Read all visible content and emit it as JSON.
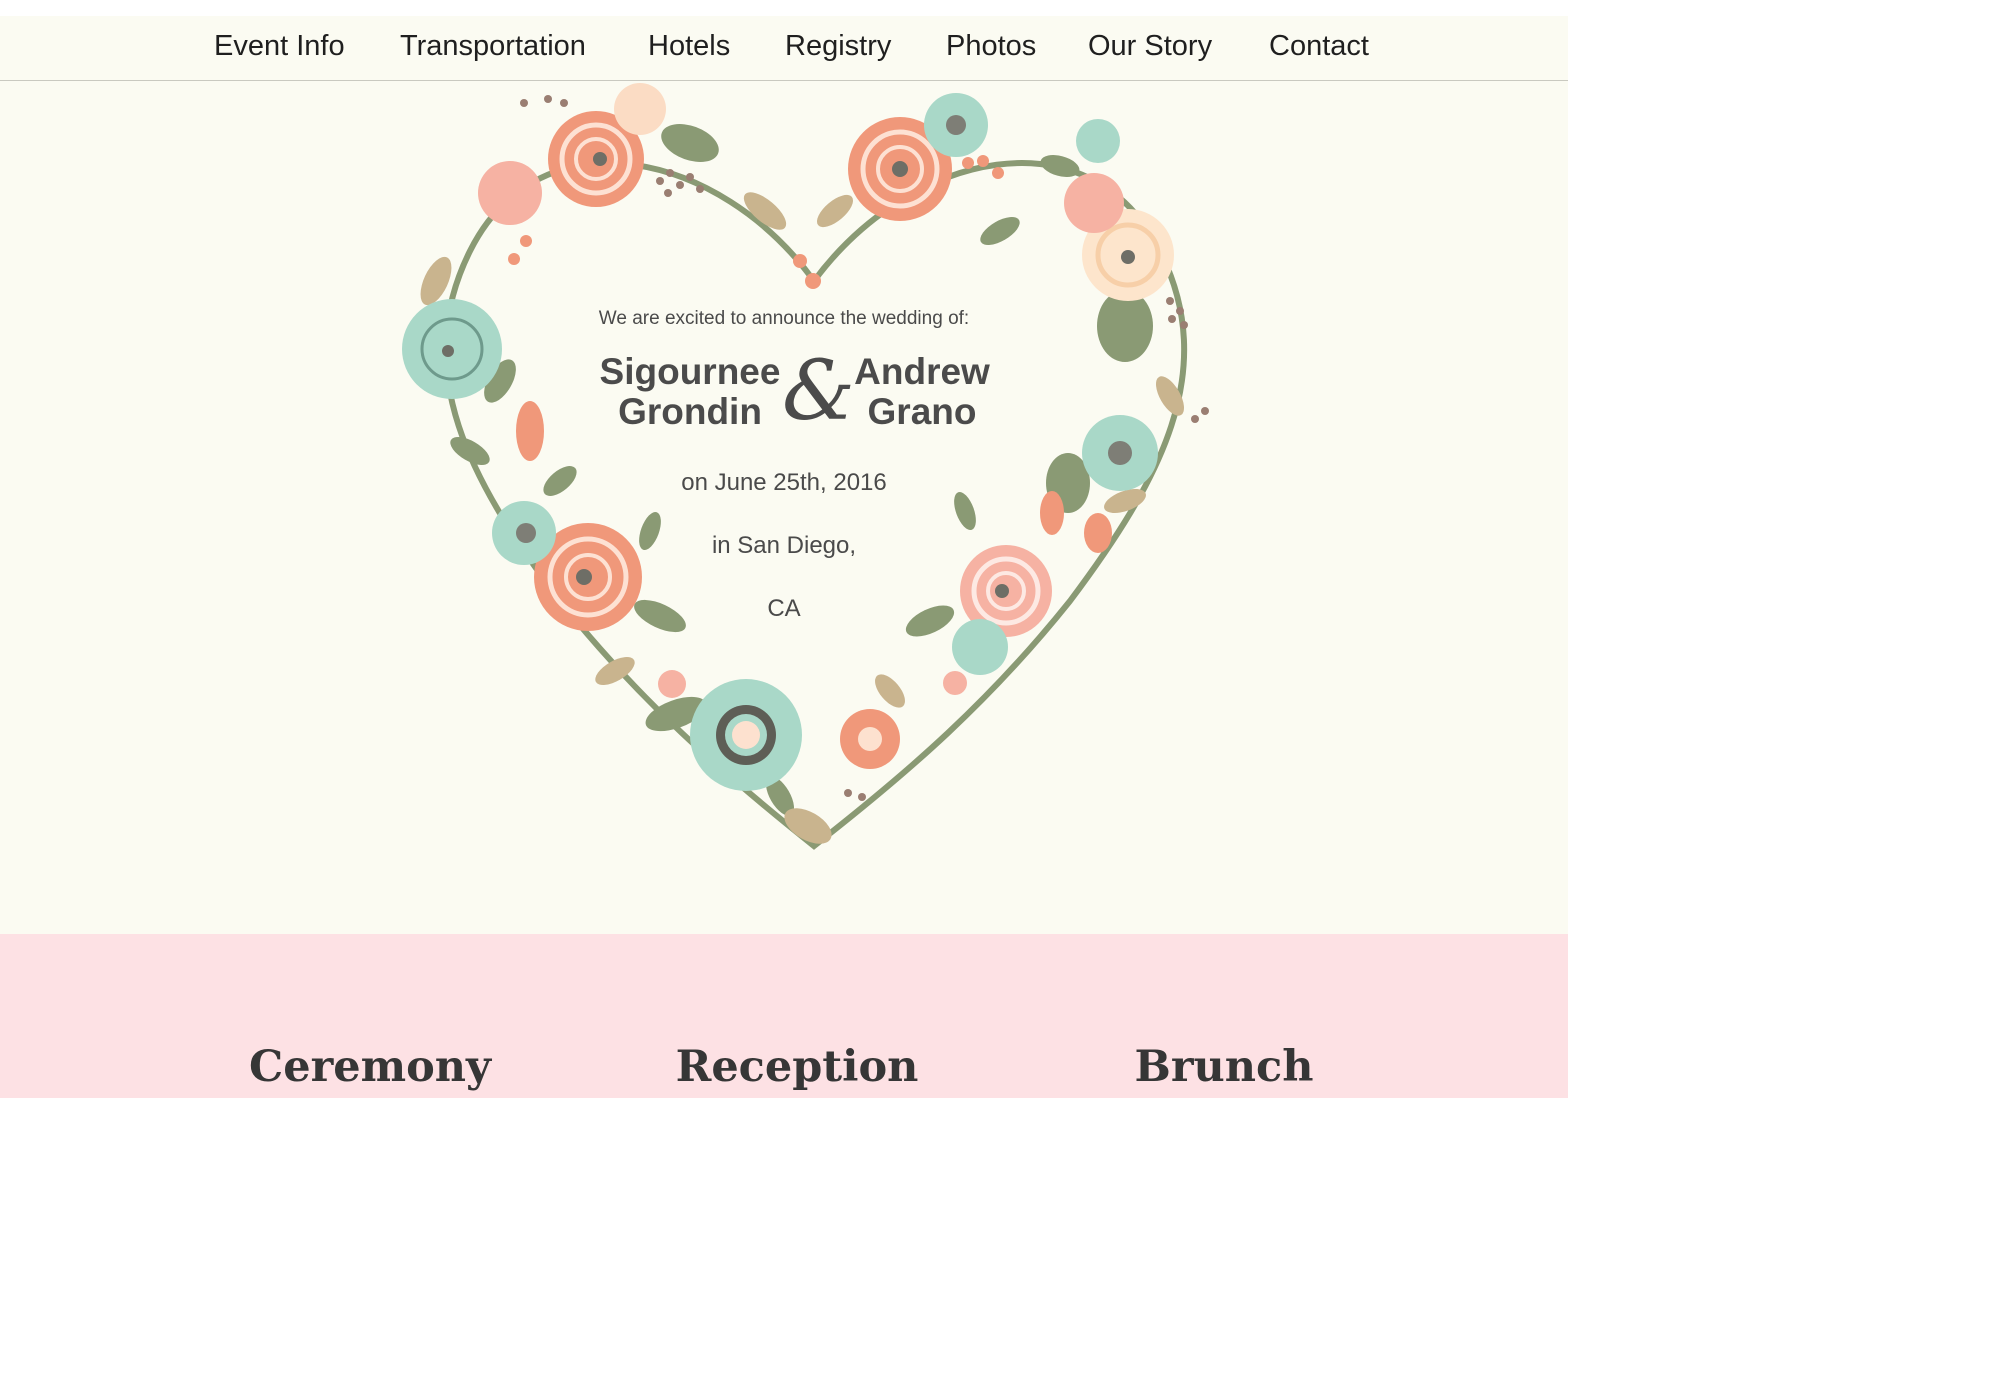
{
  "nav": {
    "items": [
      "Event Info",
      "Transportation",
      "Hotels",
      "Registry",
      "Photos",
      "Our Story",
      "Contact"
    ]
  },
  "hero": {
    "announcement": "We are excited to announce the wedding of:",
    "partner1": {
      "first": "Sigournee",
      "last": "Grondin"
    },
    "ampersand": "&",
    "partner2": {
      "first": "Andrew",
      "last": "Grano"
    },
    "date": "on June 25th, 2016",
    "city": "in San Diego,",
    "state": "CA",
    "wreath_icon": "floral-heart-wreath-icon"
  },
  "events": {
    "titles": [
      "Ceremony",
      "Reception",
      "Brunch"
    ]
  },
  "colors": {
    "nav_bg": "#fbfbf2",
    "hero_bg": "#fbfbf2",
    "events_bg": "#fde1e4",
    "coral": "#f0987a",
    "mint": "#a9d8c8",
    "sage": "#8a9a74",
    "tan": "#c9b48e"
  }
}
